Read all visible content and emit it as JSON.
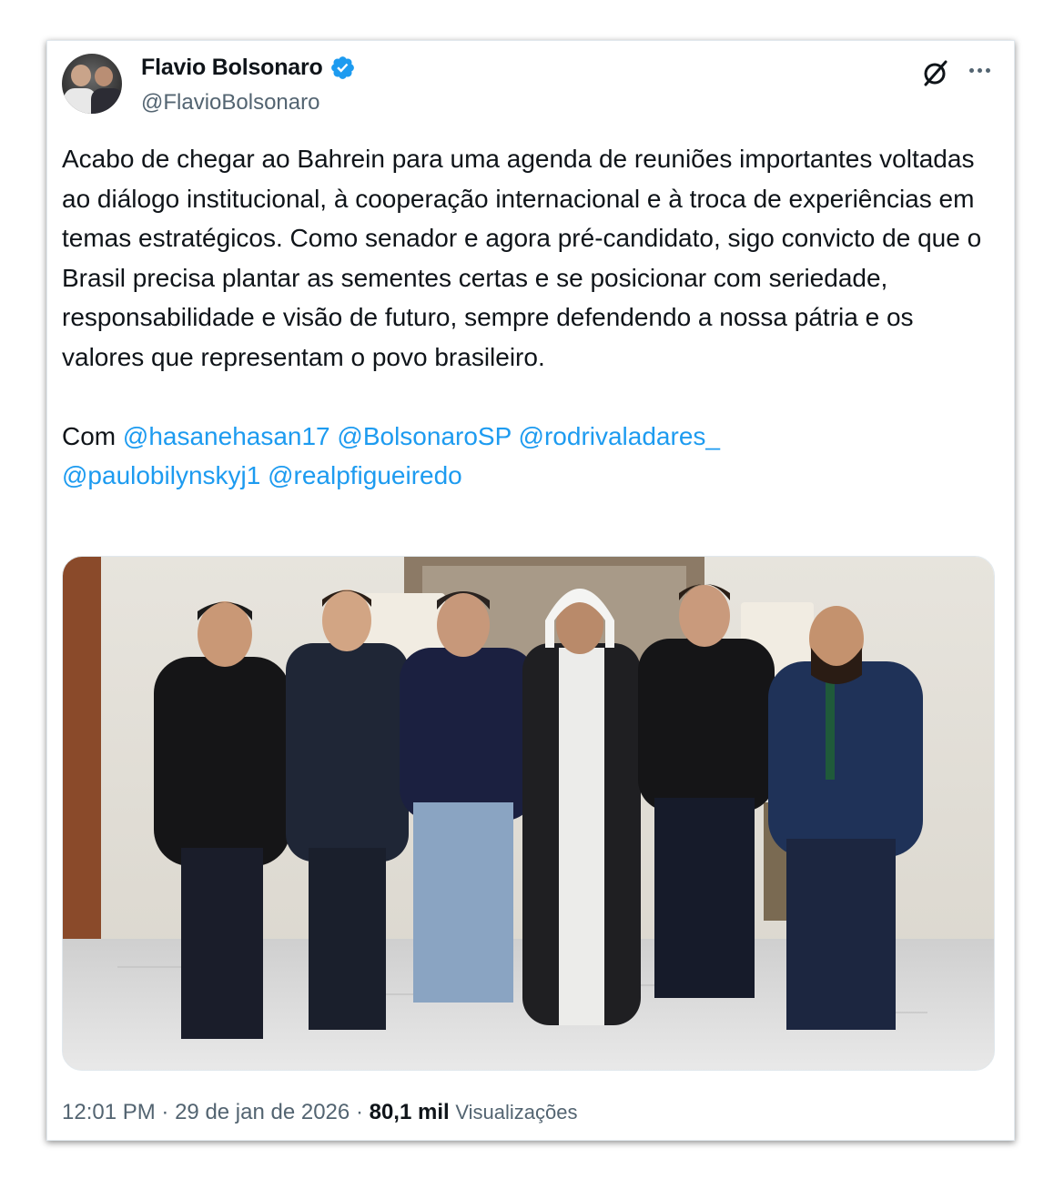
{
  "author": {
    "name": "Flavio Bolsonaro",
    "handle": "@FlavioBolsonaro",
    "verified": true,
    "verified_color": "#1d9bf0"
  },
  "tweet": {
    "paragraph1": "Acabo de chegar ao Bahrein para uma agenda de reuniões importantes voltadas ao diálogo institucional, à cooperação internacional e à troca de experiências em temas estratégicos. Como senador e agora pré-candidato, sigo convicto de que o Brasil precisa plantar as sementes certas e se posicionar com seriedade, responsabilidade e visão de futuro, sempre defendendo a nossa pátria e os valores que representam o povo brasileiro.",
    "with_prefix": "Com",
    "mentions": [
      "@hasanehasan17",
      "@BolsonaroSP",
      "@rodrivaladares_",
      "@paulobilynskyj1",
      "@realpfigueiredo"
    ]
  },
  "meta": {
    "time": "12:01 PM",
    "separator": "·",
    "date": "29 de jan de 2026",
    "views_count": "80,1 mil",
    "views_label": "Visualizações"
  },
  "icons": {
    "grok": "grok-icon",
    "more": "more-options-icon",
    "verified": "verified-badge-icon"
  },
  "colors": {
    "text_primary": "#0f1419",
    "text_secondary": "#536471",
    "link": "#1d9bf0"
  }
}
